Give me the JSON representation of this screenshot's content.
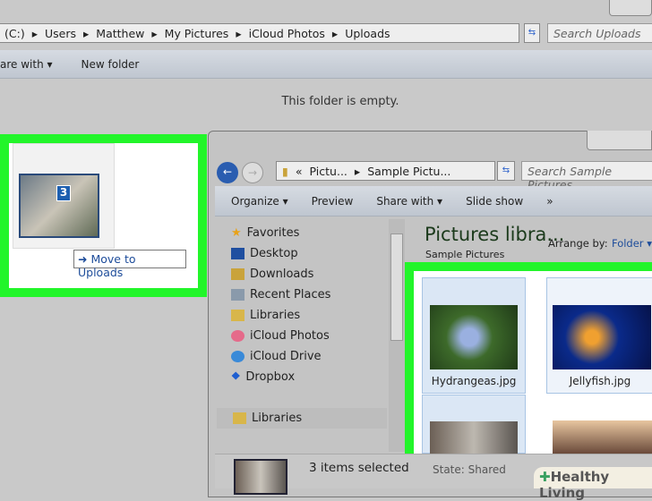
{
  "back_window": {
    "breadcrumb": [
      "(C:)",
      "Users",
      "Matthew",
      "My Pictures",
      "iCloud Photos",
      "Uploads"
    ],
    "search_placeholder": "Search Uploads",
    "toolbar": {
      "share": "are with ▾",
      "new_folder": "New folder"
    },
    "empty_text": "This folder is empty.",
    "drag": {
      "count": "3",
      "tooltip": "Move to Uploads"
    }
  },
  "front_window": {
    "breadcrumb": [
      "«",
      "Pictu...",
      "Sample Pictu..."
    ],
    "search_placeholder": "Search Sample Pictures",
    "toolbar": {
      "organize": "Organize ▾",
      "preview": "Preview",
      "share": "Share with ▾",
      "slideshow": "Slide show",
      "more": "»"
    },
    "nav": [
      "Favorites",
      "Desktop",
      "Downloads",
      "Recent Places",
      "Libraries",
      "iCloud Photos",
      "iCloud Drive",
      "Dropbox"
    ],
    "nav_libraries": "Libraries",
    "library_title": "Pictures libra...",
    "library_sub": "Sample Pictures",
    "arrange_label": "Arrange by:",
    "arrange_value": "Folder ▾",
    "files": [
      "Hydrangeas.jpg",
      "Jellyfish.jpg"
    ],
    "status": "3 items selected",
    "state": "State:",
    "state_value": "Shared"
  },
  "watermark": "Healthy Living",
  "colors": {
    "highlight": "#22f52a"
  }
}
